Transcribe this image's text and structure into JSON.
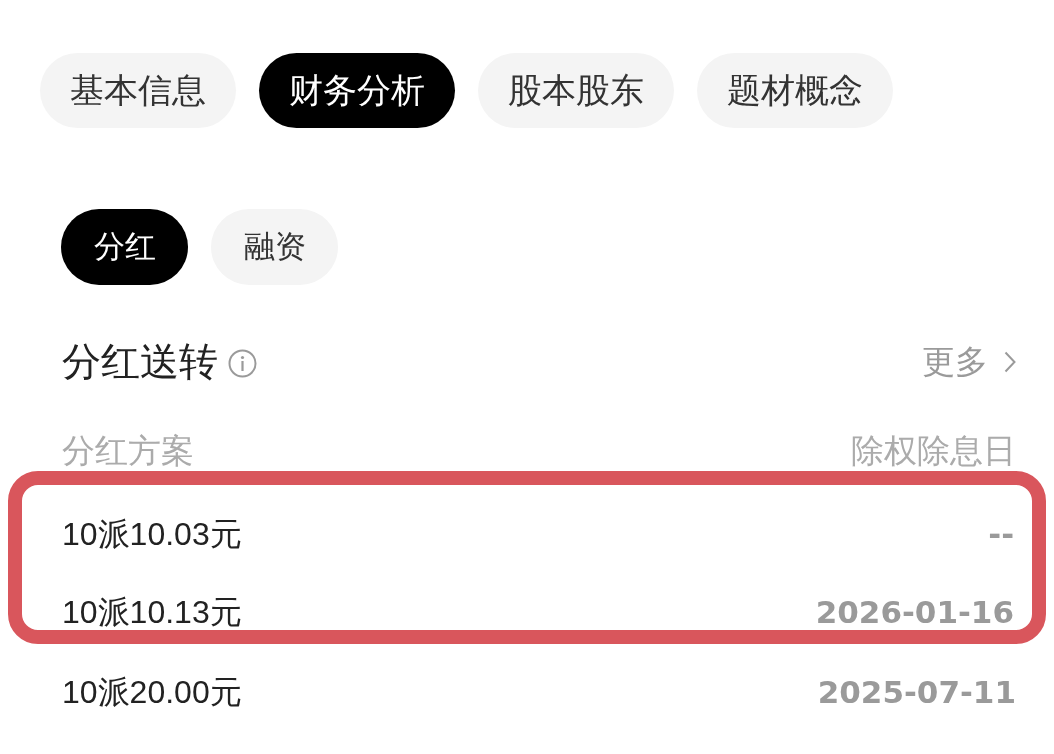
{
  "top_tabs": [
    {
      "label": "基本信息",
      "selected": false
    },
    {
      "label": "财务分析",
      "selected": true
    },
    {
      "label": "股本股东",
      "selected": false
    },
    {
      "label": "题材概念",
      "selected": false
    }
  ],
  "sub_tabs": [
    {
      "label": "分红",
      "selected": true
    },
    {
      "label": "融资",
      "selected": false
    }
  ],
  "section": {
    "title": "分红送转",
    "more_link": "更多"
  },
  "table": {
    "columns": [
      "分红方案",
      "除权除息日"
    ],
    "rows": [
      {
        "plan": "10派10.03元",
        "ex_date": "--",
        "highlighted": true
      },
      {
        "plan": "10派10.13元",
        "ex_date": "2026-01-16",
        "highlighted": true
      },
      {
        "plan": "10派20.00元",
        "ex_date": "2025-07-11",
        "highlighted": false
      }
    ]
  }
}
